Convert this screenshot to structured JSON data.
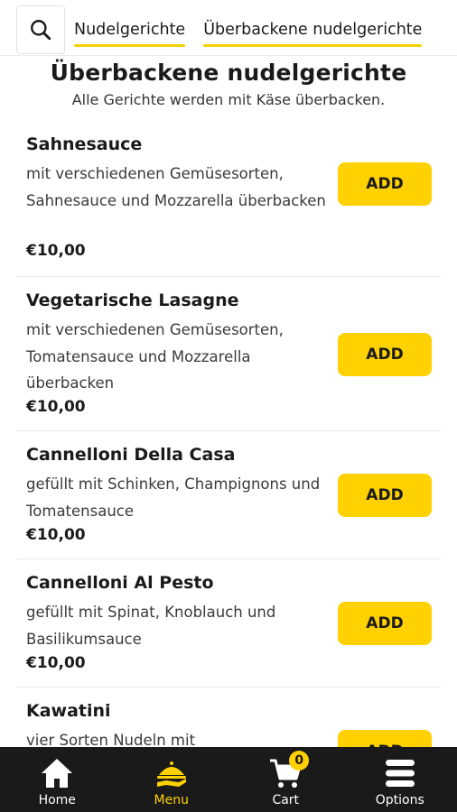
{
  "search": {
    "icon": "search-icon"
  },
  "tabs": [
    {
      "label": "Nudelgerichte"
    },
    {
      "label": "Überbackene nudelgerichte"
    }
  ],
  "section": {
    "title": "Überbackene nudelgerichte",
    "subtitle": "Alle Gerichte werden mit Käse überbacken."
  },
  "items": [
    {
      "name": "Sahnesauce",
      "desc": "mit verschiedenen Gemüsesorten, Sahnesauce und Mozzarella überbacken",
      "price": "€10,00",
      "add": "ADD"
    },
    {
      "name": "Vegetarische Lasagne",
      "desc": "mit verschiedenen Gemüsesorten, Tomatensauce und Mozzarella überbacken",
      "price": "€10,00",
      "add": "ADD"
    },
    {
      "name": "Cannelloni Della Casa",
      "desc": "gefüllt mit Schinken, Champignons und Tomatensauce",
      "price": "€10,00",
      "add": "ADD"
    },
    {
      "name": "Cannelloni Al Pesto",
      "desc": "gefüllt mit Spinat, Knoblauch und Basilikumsauce",
      "price": "€10,00",
      "add": "ADD"
    },
    {
      "name": "Kawatini",
      "desc": "vier Sorten Nudeln mit",
      "price": "",
      "add": "ADD"
    }
  ],
  "nav": [
    {
      "label": "Home",
      "icon": "home-icon"
    },
    {
      "label": "Menu",
      "icon": "menu-food-icon"
    },
    {
      "label": "Cart",
      "icon": "cart-icon",
      "badge": "0"
    },
    {
      "label": "Options",
      "icon": "hamburger-icon"
    }
  ],
  "colors": {
    "accent": "#ffd100",
    "nav_bg": "#1a1a1a"
  }
}
